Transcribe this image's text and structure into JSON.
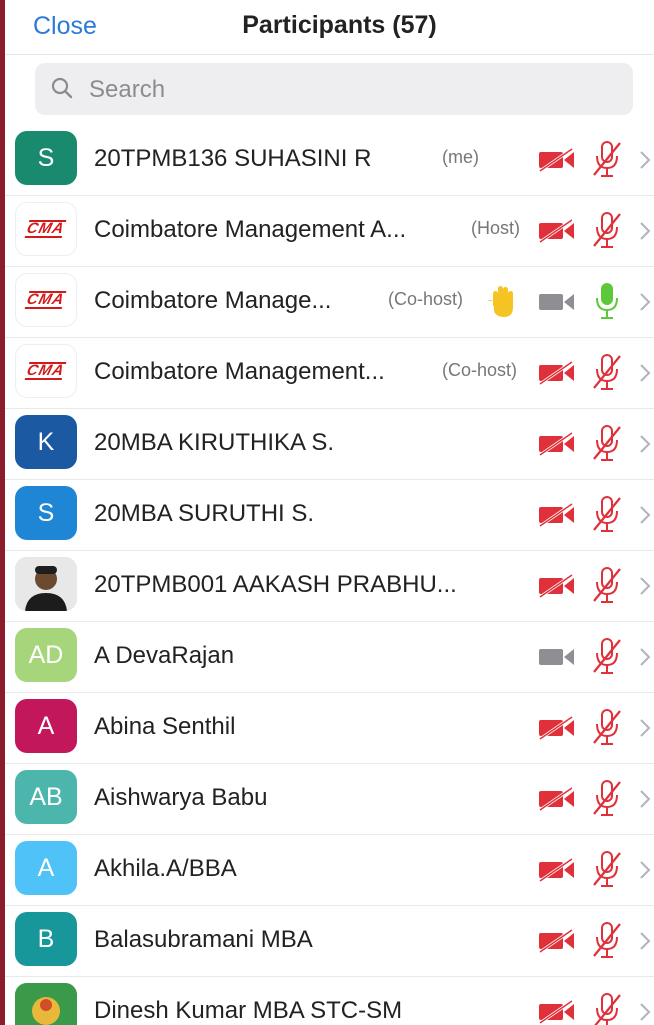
{
  "header": {
    "close_label": "Close",
    "title": "Participants (57)"
  },
  "search": {
    "placeholder": "Search"
  },
  "colors": {
    "accent": "#2d7ad6",
    "muted_red": "#e0313a",
    "mic_green": "#5cc83a",
    "icon_gray": "#8e8e93"
  },
  "participants": [
    {
      "initials": "S",
      "avatar_color": "#1a8a6e",
      "name": "20TPMB136 SUHASINI R",
      "role": "(me)",
      "video": "off",
      "mic": "muted",
      "hand": false,
      "avatar_type": "initials"
    },
    {
      "initials": "",
      "avatar_color": "#ffffff",
      "logo_text": "CMA",
      "name": "Coimbatore Management A...",
      "role": "(Host)",
      "video": "off",
      "mic": "muted",
      "hand": false,
      "avatar_type": "logo"
    },
    {
      "initials": "",
      "avatar_color": "#ffffff",
      "logo_text": "CMA",
      "name": "Coimbatore Manage...",
      "role": "(Co-host)",
      "video": "gray",
      "mic": "on",
      "hand": true,
      "avatar_type": "logo"
    },
    {
      "initials": "",
      "avatar_color": "#ffffff",
      "logo_text": "CMA",
      "name": "Coimbatore Management...",
      "role": "(Co-host)",
      "video": "off",
      "mic": "muted",
      "hand": false,
      "avatar_type": "logo"
    },
    {
      "initials": "K",
      "avatar_color": "#1b5aa3",
      "name": "20MBA KIRUTHIKA S.",
      "role": "",
      "video": "off",
      "mic": "muted",
      "hand": false,
      "avatar_type": "initials"
    },
    {
      "initials": "S",
      "avatar_color": "#1e86d4",
      "name": "20MBA SURUTHI S.",
      "role": "",
      "video": "off",
      "mic": "muted",
      "hand": false,
      "avatar_type": "initials"
    },
    {
      "initials": "",
      "avatar_color": "#d9d9d9",
      "name": "20TPMB001 AAKASH PRABHU...",
      "role": "",
      "video": "off",
      "mic": "muted",
      "hand": false,
      "avatar_type": "photo"
    },
    {
      "initials": "AD",
      "avatar_color": "#a6d57c",
      "name": "A DevaRajan",
      "role": "",
      "video": "gray",
      "mic": "muted",
      "hand": false,
      "avatar_type": "initials"
    },
    {
      "initials": "A",
      "avatar_color": "#c2185b",
      "name": "Abina Senthil",
      "role": "",
      "video": "off",
      "mic": "muted",
      "hand": false,
      "avatar_type": "initials"
    },
    {
      "initials": "AB",
      "avatar_color": "#4db6ac",
      "name": "Aishwarya Babu",
      "role": "",
      "video": "off",
      "mic": "muted",
      "hand": false,
      "avatar_type": "initials"
    },
    {
      "initials": "A",
      "avatar_color": "#4fc3f7",
      "name": "Akhila.A/BBA",
      "role": "",
      "video": "off",
      "mic": "muted",
      "hand": false,
      "avatar_type": "initials"
    },
    {
      "initials": "B",
      "avatar_color": "#17979a",
      "name": "Balasubramani MBA",
      "role": "",
      "video": "off",
      "mic": "muted",
      "hand": false,
      "avatar_type": "initials"
    },
    {
      "initials": "",
      "avatar_color": "#3a9a4a",
      "name": "Dinesh Kumar MBA STC-SM",
      "role": "",
      "video": "off",
      "mic": "muted",
      "hand": false,
      "avatar_type": "photo2"
    }
  ]
}
